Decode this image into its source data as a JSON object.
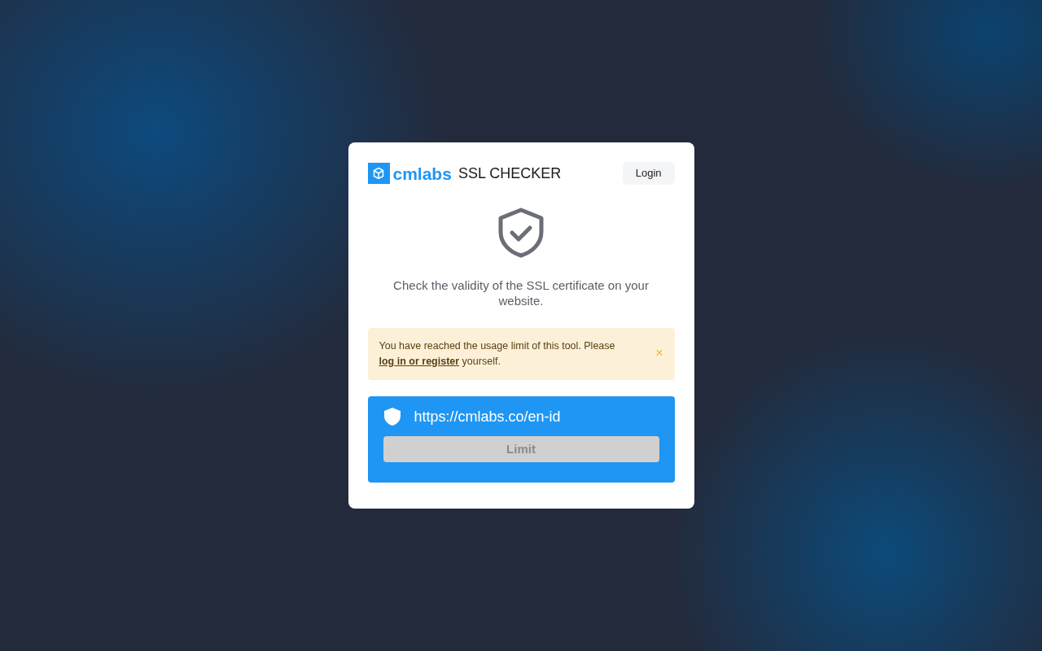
{
  "header": {
    "brand": "cmlabs",
    "title": "SSL CHECKER",
    "login_button": "Login"
  },
  "description": "Check the validity of the SSL certificate on your website.",
  "alert": {
    "text_before": "You have reached the usage limit of this tool. Please ",
    "link": "log in or register",
    "text_after": " yourself.",
    "close": "×"
  },
  "checker": {
    "url": "https://cmlabs.co/en-id",
    "button": {
      "label": "Limit",
      "disabled": true
    }
  }
}
